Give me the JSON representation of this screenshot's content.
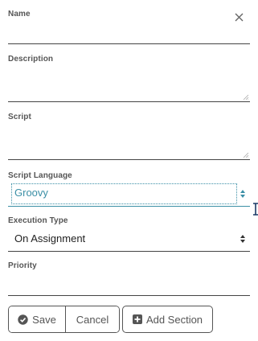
{
  "form": {
    "name": {
      "label": "Name",
      "value": ""
    },
    "description": {
      "label": "Description",
      "value": ""
    },
    "script": {
      "label": "Script",
      "value": ""
    },
    "script_language": {
      "label": "Script Language",
      "selected": "Groovy"
    },
    "execution_type": {
      "label": "Execution Type",
      "selected": "On Assignment"
    },
    "priority": {
      "label": "Priority",
      "value": ""
    }
  },
  "buttons": {
    "save": {
      "label": "Save",
      "icon": "check-circle-icon"
    },
    "cancel": {
      "label": "Cancel"
    },
    "add_section": {
      "label": "Add Section",
      "icon": "plus-square-icon"
    }
  },
  "colors": {
    "focus_accent": "#3b8fa6",
    "text": "#333333",
    "border": "#555555"
  }
}
